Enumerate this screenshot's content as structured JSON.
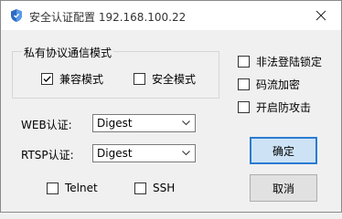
{
  "window": {
    "title": "安全认证配置   192.168.100.22",
    "app_icon": "shield-icon",
    "close_icon": "close-icon"
  },
  "private_protocol": {
    "group_label": "私有协议通信模式",
    "compat_mode": {
      "label": "兼容模式",
      "checked": true
    },
    "secure_mode": {
      "label": "安全模式",
      "checked": false
    }
  },
  "options": {
    "illegal_login_lock": {
      "label": "非法登陆锁定",
      "checked": false
    },
    "stream_encrypt": {
      "label": "码流加密",
      "checked": false
    },
    "anti_attack": {
      "label": "开启防攻击",
      "checked": false
    }
  },
  "web_auth": {
    "label": "WEB认证:",
    "value": "Digest"
  },
  "rtsp_auth": {
    "label": "RTSP认证:",
    "value": "Digest"
  },
  "protocols": {
    "telnet": {
      "label": "Telnet",
      "checked": false
    },
    "ssh": {
      "label": "SSH",
      "checked": false
    }
  },
  "buttons": {
    "ok": "确定",
    "cancel": "取消"
  },
  "colors": {
    "default_button_border": "#2b7bd1",
    "default_button_bg": "#cde3f5"
  }
}
